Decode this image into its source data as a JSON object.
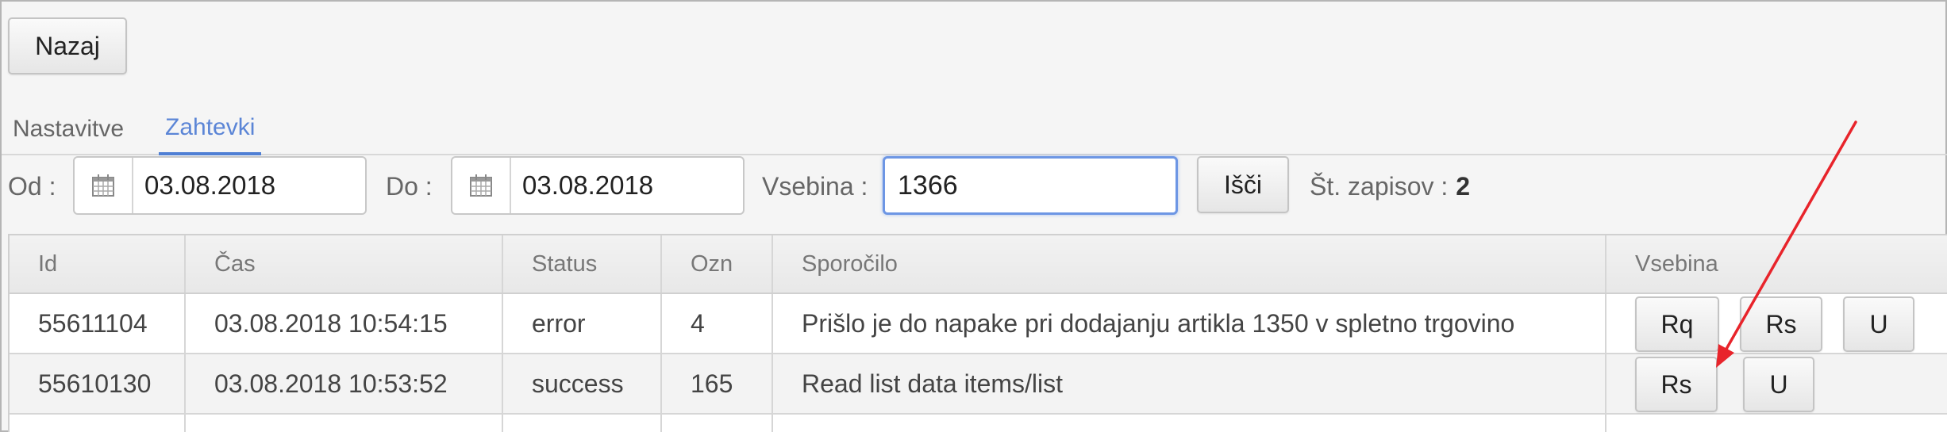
{
  "back_label": "Nazaj",
  "tabs": {
    "settings": "Nastavitve",
    "requests": "Zahtevki"
  },
  "filters": {
    "from_label": "Od :",
    "from_value": "03.08.2018",
    "to_label": "Do :",
    "to_value": "03.08.2018",
    "content_label": "Vsebina :",
    "content_value": "1366",
    "search_label": "Išči",
    "count_label": "Št. zapisov :",
    "count_value": "2"
  },
  "table": {
    "headers": {
      "id": "Id",
      "time": "Čas",
      "status": "Status",
      "ozn": "Ozn",
      "message": "Sporočilo",
      "content": "Vsebina"
    },
    "rows": [
      {
        "id": "55611104",
        "time": "03.08.2018 10:54:15",
        "status": "error",
        "ozn": "4",
        "message": "Prišlo je do napake pri dodajanju artikla 1350 v spletno trgovino",
        "actions": [
          "Rq",
          "Rs",
          "U"
        ]
      },
      {
        "id": "55610130",
        "time": "03.08.2018 10:53:52",
        "status": "success",
        "ozn": "165",
        "message": "Read list data items/list",
        "actions": [
          "Rs",
          "U"
        ]
      }
    ]
  },
  "colors": {
    "accent": "#4f7fd4",
    "annotation_arrow": "#e8242b"
  },
  "icons": {
    "date_picker": "calendar-icon",
    "annotation": "arrow-annotation"
  }
}
